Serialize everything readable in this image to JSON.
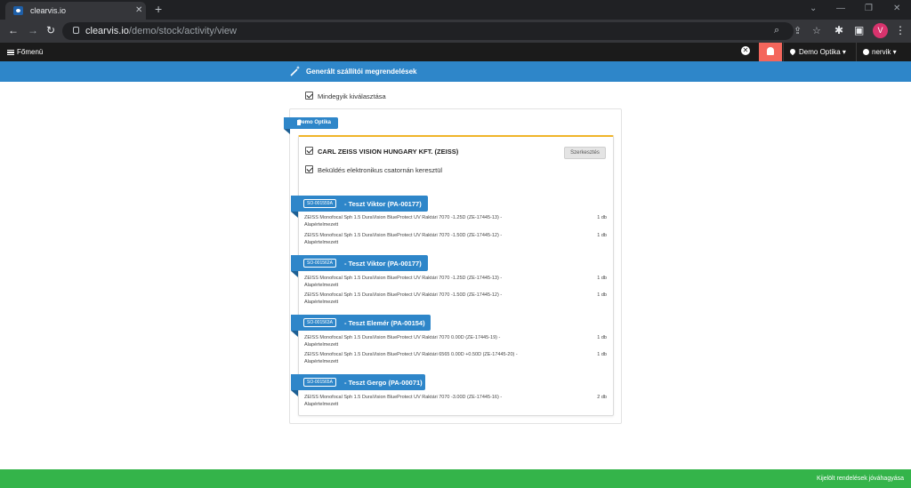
{
  "browser": {
    "tab_title": "clearvis.io",
    "url_host": "clearvis.io",
    "url_path": "/demo/stock/activity/view",
    "profile_initial": "V"
  },
  "nav": {
    "menu_label": "Főmenü",
    "store_label": "Demo Optika",
    "user_label": "nervik"
  },
  "page": {
    "title": "Generált szállítói megrendelések",
    "select_all_label": "Mindegyik kiválasztása"
  },
  "store": {
    "name": "Demo Optika",
    "supplier": {
      "name": "CARL ZEISS VISION HUNGARY KFT. (ZEISS)",
      "edit_label": "Szerkesztés",
      "electronic_label": "Beküldés elektronikus csatornán keresztül"
    },
    "orders": [
      {
        "so": "SO-001559A",
        "title": "- Teszt Viktor (PA-00177)",
        "items": [
          {
            "desc": "ZEISS Monofocal Sph 1.5 DuraVision BlueProtect UV Raktári 7070 -1.25D (ZE-17445-13) - Alapértelmezett",
            "qty": "1 db"
          },
          {
            "desc": "ZEISS Monofocal Sph 1.5 DuraVision BlueProtect UV Raktári 7070 -1.50D (ZE-17445-12) - Alapértelmezett",
            "qty": "1 db"
          }
        ]
      },
      {
        "so": "SO-001562A",
        "title": "- Teszt Viktor (PA-00177)",
        "items": [
          {
            "desc": "ZEISS Monofocal Sph 1.5 DuraVision BlueProtect UV Raktári 7070 -1.25D (ZE-17445-13) - Alapértelmezett",
            "qty": "1 db"
          },
          {
            "desc": "ZEISS Monofocal Sph 1.5 DuraVision BlueProtect UV Raktári 7070 -1.50D (ZE-17445-12) - Alapértelmezett",
            "qty": "1 db"
          }
        ]
      },
      {
        "so": "SO-001563A",
        "title": "- Teszt Elemér (PA-00154)",
        "items": [
          {
            "desc": "ZEISS Monofocal Sph 1.5 DuraVision BlueProtect UV Raktári 7070 0.00D (ZE-17445-19) - Alapértelmezett",
            "qty": "1 db"
          },
          {
            "desc": "ZEISS Monofocal Sph 1.5 DuraVision BlueProtect UV Raktári 6565 0.00D +0.50D (ZE-17445-20) - Alapértelmezett",
            "qty": "1 db"
          }
        ]
      },
      {
        "so": "SO-001565A",
        "title": "- Teszt Gergo (PA-00071)",
        "items": [
          {
            "desc": "ZEISS Monofocal Sph 1.5 DuraVision BlueProtect UV Raktári 7070 -3.00D (ZE-17445-16) - Alapértelmezett",
            "qty": "2 db"
          }
        ]
      }
    ]
  },
  "footer": {
    "approve_label": "Kijelölt rendelések jóváhagyása"
  },
  "colors": {
    "accent_blue": "#2e86c9",
    "approve_green": "#34b44a",
    "alert_red": "#f4665c",
    "supplier_border": "#f0b429"
  }
}
